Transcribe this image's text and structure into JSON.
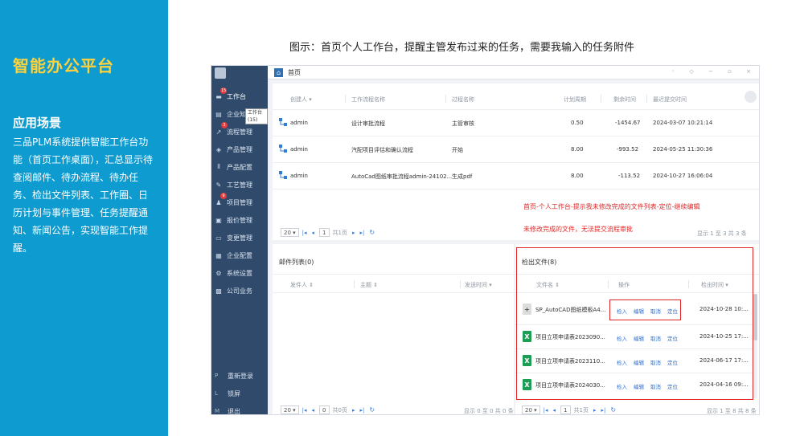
{
  "left_panel": {
    "title": "智能办公平台",
    "subtitle": "应用场景",
    "description": "三品PLM系统提供智能工作台功能（首页工作桌面），汇总显示待查阅邮件、待办流程、待办任务、检出文件列表、工作圈、日历计划与事件管理、任务提醒通知、新闻公告，实现智能工作提醒。"
  },
  "caption": "图示：首页个人工作台，提醒主管发布过来的任务，需要我输入的任务附件",
  "nav": {
    "items": [
      {
        "label": "工作台",
        "icon": "desk-icon",
        "badge": "15"
      },
      {
        "label": "企业知",
        "icon": "book-icon",
        "badge": ""
      },
      {
        "label": "流程管理",
        "icon": "flow-icon",
        "badge": "3"
      },
      {
        "label": "产品管理",
        "icon": "product-icon",
        "badge": ""
      },
      {
        "label": "产品配置",
        "icon": "config-icon",
        "badge": ""
      },
      {
        "label": "工艺管理",
        "icon": "process-icon",
        "badge": ""
      },
      {
        "label": "项目管理",
        "icon": "project-icon",
        "badge": "9"
      },
      {
        "label": "报价管理",
        "icon": "quote-icon",
        "badge": ""
      },
      {
        "label": "变更管理",
        "icon": "change-icon",
        "badge": ""
      },
      {
        "label": "企业配置",
        "icon": "enterprise-icon",
        "badge": ""
      },
      {
        "label": "系统设置",
        "icon": "gear-icon",
        "badge": ""
      },
      {
        "label": "公司业务",
        "icon": "business-icon",
        "badge": ""
      }
    ],
    "tooltip": "工作台(15)",
    "bottom": [
      {
        "letter": "P",
        "label": "重新登录"
      },
      {
        "letter": "L",
        "label": "锁屏"
      },
      {
        "letter": "M",
        "label": "退出"
      }
    ]
  },
  "topbar": {
    "tab": "首页",
    "controls": "◦ ◇ − ▫ ×"
  },
  "tasks": {
    "headers": [
      "创建人 ▾",
      "工作流程名称",
      "过程名称",
      "计划周期",
      "剩余时间",
      "最迟提交时间"
    ],
    "rows": [
      {
        "creator": "admin",
        "workflow": "设计审批流程",
        "process": "主管审核",
        "cycle": "0.50",
        "remaining": "-1454.67",
        "deadline": "2024-03-07 10:21:14"
      },
      {
        "creator": "admin",
        "workflow": "汽配项目评估和确认流程",
        "process": "开始",
        "cycle": "8.00",
        "remaining": "-993.52",
        "deadline": "2024-05-25 11:30:36"
      },
      {
        "creator": "admin",
        "workflow": "AutoCad图纸审批流程admin-24102...",
        "process": "生成pdf",
        "cycle": "8.00",
        "remaining": "-113.52",
        "deadline": "2024-10-27 16:06:04"
      }
    ],
    "note1": "首页-个人工作台-提示我未修改完成的文件列表-定位-继续编辑",
    "note2": "未修改完成的文件，无法提交流程审批",
    "pager": {
      "size": "20 ▾",
      "page": "1",
      "total": "共1页",
      "summary": "显示 1 至 3 共 3 条"
    }
  },
  "mail": {
    "title": "邮件列表(0)",
    "headers": [
      "发件人 ⇕",
      "主题 ⇕",
      "发送时间 ▾"
    ],
    "pager": {
      "size": "20 ▾",
      "page": "0",
      "total": "共0页",
      "summary": "显示 0 至 0 共 0 条"
    }
  },
  "checkout": {
    "title": "检出文件(8)",
    "headers": [
      "文件名 ⇕",
      "操作",
      "检出时间 ▾"
    ],
    "actions": [
      "检入",
      "编辑",
      "取消",
      "定位"
    ],
    "rows": [
      {
        "name": "SP_AutoCAD图纸模板A4...",
        "type": "cad",
        "time": "2024-10-28 10:..."
      },
      {
        "name": "项目立项申请表2023090...",
        "type": "xls",
        "time": "2024-10-25 17:..."
      },
      {
        "name": "项目立项申请表2023110...",
        "type": "xls",
        "time": "2024-06-17 17:..."
      },
      {
        "name": "项目立项申请表2024030...",
        "type": "xls",
        "time": "2024-04-16 09:..."
      }
    ],
    "pager": {
      "size": "20 ▾",
      "page": "1",
      "total": "共1页",
      "summary": "显示 1 至 8 共 8 条"
    }
  }
}
